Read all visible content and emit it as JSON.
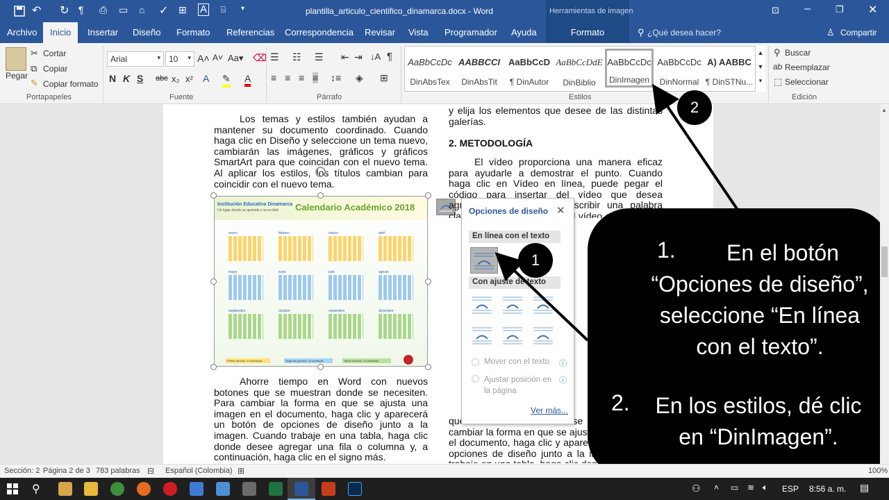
{
  "window": {
    "title": "plantilla_articulo_cientifico_dinamarca.docx  -  Word",
    "context_tab": "Herramientas de imagen"
  },
  "tabs": [
    "Archivo",
    "Inicio",
    "Insertar",
    "Diseño",
    "Formato",
    "Referencias",
    "Correspondencia",
    "Revisar",
    "Vista",
    "Programador",
    "Ayuda",
    "Formato"
  ],
  "tell_me": "¿Qué desea hacer?",
  "share": "Compartir",
  "clipboard": {
    "paste": "Pegar",
    "cut": "Cortar",
    "copy": "Copiar",
    "format_painter": "Copiar formato",
    "label": "Portapapeles"
  },
  "font": {
    "name": "Arial",
    "size": "10",
    "label": "Fuente"
  },
  "paragraph": {
    "label": "Párrafo"
  },
  "styles": {
    "label": "Estilos",
    "items": [
      {
        "sample": "AaBbCcDc",
        "name": "DinAbsTex"
      },
      {
        "sample": "AABBCCI",
        "name": "DinAbsTit"
      },
      {
        "sample": "AaBbCcD",
        "name": "¶ DinAutor"
      },
      {
        "sample": "AaBbCcDdE",
        "name": "DinBiblio"
      },
      {
        "sample": "AaBbCcDc",
        "name": "DinImagen"
      },
      {
        "sample": "AaBbCcDc",
        "name": "DinNormal"
      },
      {
        "sample": "A) AABBC",
        "name": "¶ DinSTNu..."
      }
    ]
  },
  "editing": {
    "find": "Buscar",
    "replace": "Reemplazar",
    "select": "Seleccionar",
    "label": "Edición"
  },
  "document": {
    "left_para1": "Los temas y estilos también ayudan a mantener su documento coordinado. Cuando haga clic en Diseño y seleccione un tema nuevo, cambiarán las imágenes, gráficos y gráficos SmartArt para que coincidan con el nuevo tema. Al aplicar los estilos, los títulos cambian para coincidir con el nuevo tema.",
    "left_para2": "Ahorre tiempo en Word con nuevos botones que se muestran donde se necesiten. Para cambiar la forma en que se ajusta una imagen en el documento, haga clic y aparecerá un botón de opciones de diseño junto a la imagen. Cuando trabaje en una tabla, haga clic donde desee agregar una fila o columna y, a continuación, haga clic en el signo más.",
    "right_top": "y elija los elementos que desee de las distintas galerías.",
    "heading": "2.   METODOLOGÍA",
    "right_para1": "El vídeo proporciona una manera eficaz para ayudarle a demostrar el punto. Cuando haga clic en Vídeo en línea, puede pegar el código para insertar del vídeo que desea agregar. También puede escribir una palabra clave para buscar en línea el vídeo que mejor se adapte a su documento.",
    "right_bottom": "que se muestran donde se necesiten. Para cambiar la forma en que se ajusta una imagen en el documento, haga clic y aparecerá un botón de opciones de diseño junto a la imagen. Cuando trabaje en una tabla, haga clic donde desee"
  },
  "calendar": {
    "institution": "Institución Educativa Dinamarca",
    "motto": "Un lugar donde se aprende y se es feliz",
    "title": "Calendario Académico 2018",
    "months": [
      "enero",
      "febrero",
      "marzo",
      "abril",
      "mayo",
      "junio",
      "julio",
      "agosto",
      "septiembre",
      "octubre",
      "noviembre",
      "diciembre"
    ],
    "periods": [
      "Primer período: 13 semanas",
      "Segundo período: 13 semanas",
      "Tercer período: 14 semanas"
    ]
  },
  "layout_popup": {
    "title": "Opciones de diseño",
    "inline_section": "En línea con el texto",
    "wrap_section": "Con ajuste de texto",
    "move_with_text": "Mover con el texto",
    "fix_position": "Ajustar posición en la página",
    "see_more": "Ver más..."
  },
  "callout": {
    "step1": "En el botón “Opciones de diseño”, seleccione “En línea con el texto”.",
    "step2": "En los estilos, dé clic en “DinImagen”.",
    "num1": "1.",
    "num2": "2."
  },
  "markers": {
    "m1": "1",
    "m2": "2"
  },
  "status": {
    "section": "Sección: 2",
    "page": "Página 2 de 3",
    "words": "783 palabras",
    "language": "Español (Colombia)",
    "zoom": "100%"
  },
  "taskbar": {
    "lang": "ESP",
    "time": "8:56 a. m."
  },
  "colors": {
    "accent": "#2b579a",
    "callout": "#000000"
  }
}
